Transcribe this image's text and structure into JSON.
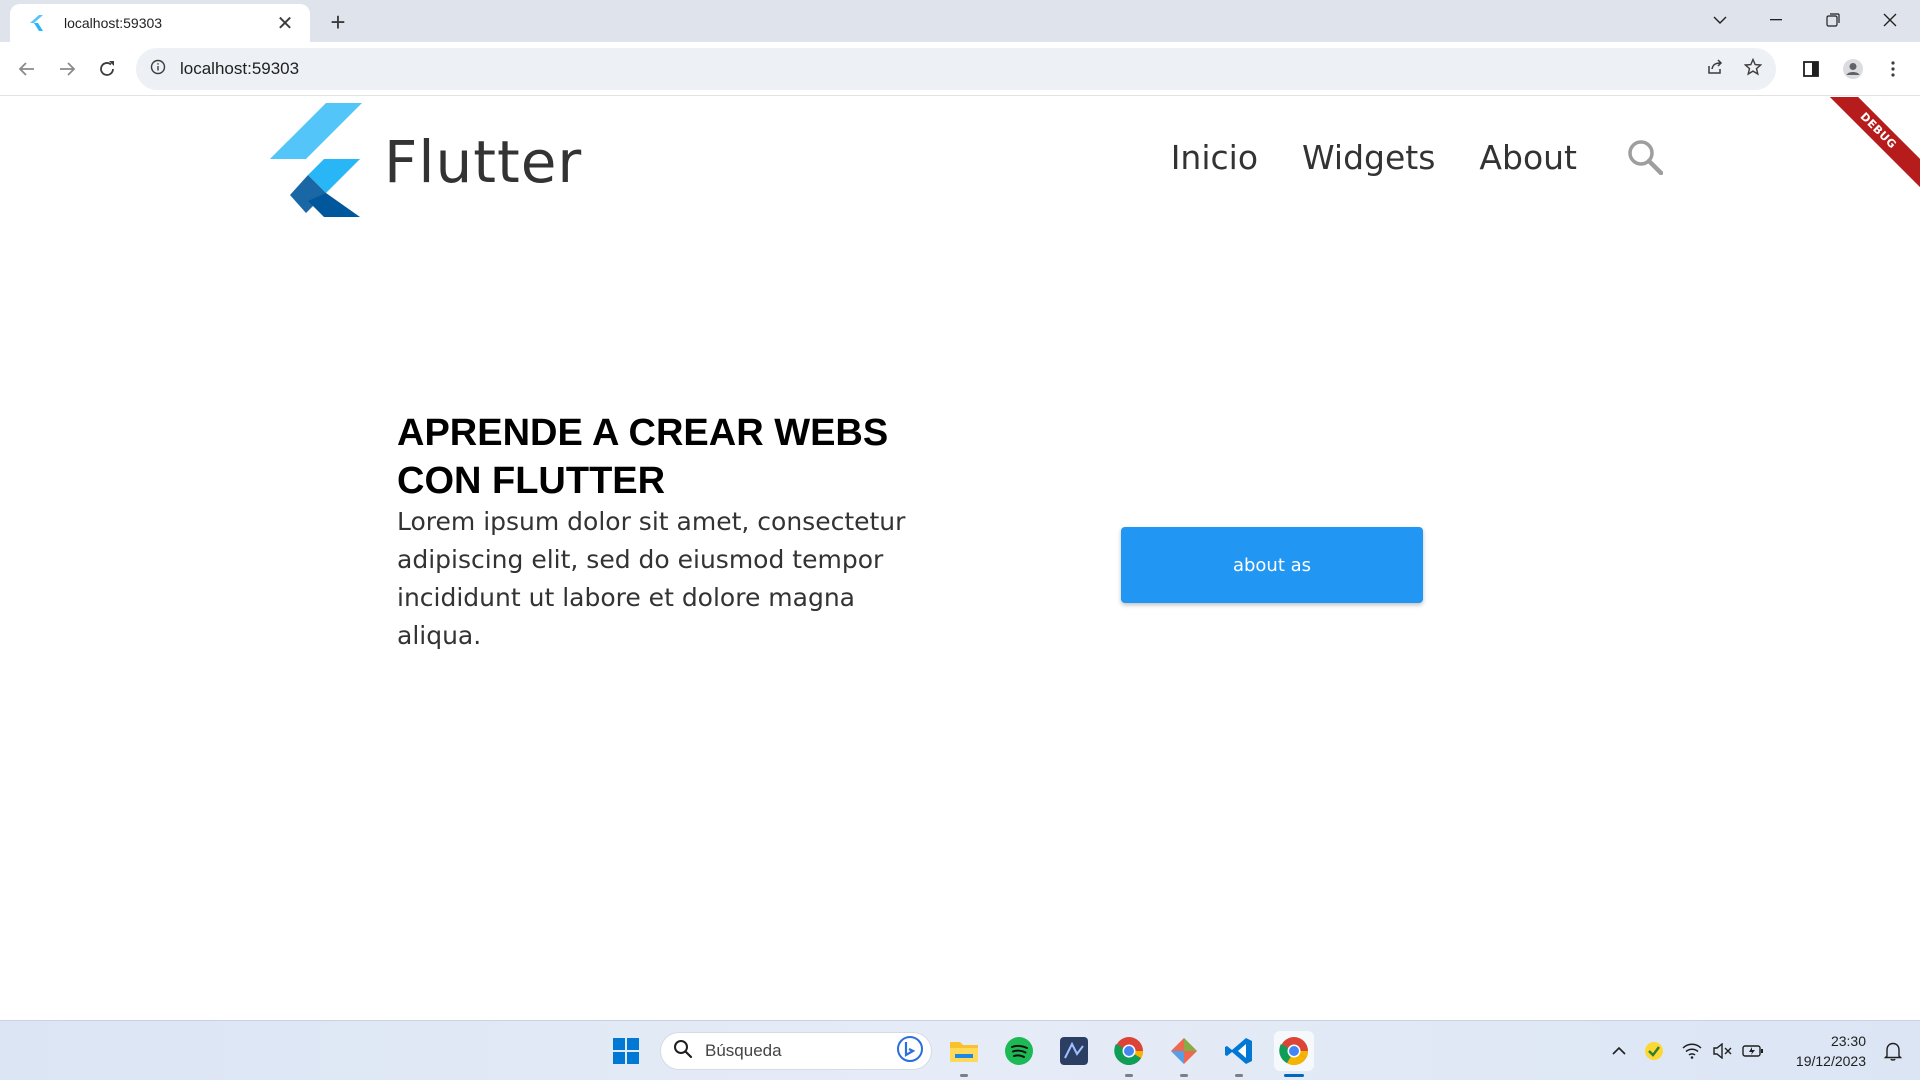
{
  "browser": {
    "tab_title": "localhost:59303",
    "tab_close": "✕",
    "new_tab": "+",
    "url": "localhost:59303"
  },
  "page": {
    "debug_banner": "DEBUG",
    "logo_text": "Flutter",
    "nav": {
      "items": [
        {
          "label": "Inicio"
        },
        {
          "label": "Widgets"
        },
        {
          "label": "About"
        }
      ]
    },
    "hero": {
      "title": "APRENDE A CREAR WEBS CON FLUTTER",
      "description": "Lorem ipsum dolor sit amet, consectetur adipiscing elit, sed do eiusmod tempor incididunt ut labore et dolore magna aliqua."
    },
    "button_label": "about as",
    "colors": {
      "button": "#2196f3",
      "debug": "#b71c1c",
      "flutter_light": "#54c5f8",
      "flutter_mid": "#29b6f6",
      "flutter_dark": "#01579b"
    }
  },
  "taskbar": {
    "search_placeholder": "Búsqueda",
    "apps": [
      "start-icon",
      "file-explorer-icon",
      "spotify-icon",
      "app-icon",
      "chrome-icon",
      "git-icon",
      "vscode-icon",
      "chrome-active-icon"
    ],
    "time": "23:30",
    "date": "19/12/2023"
  }
}
